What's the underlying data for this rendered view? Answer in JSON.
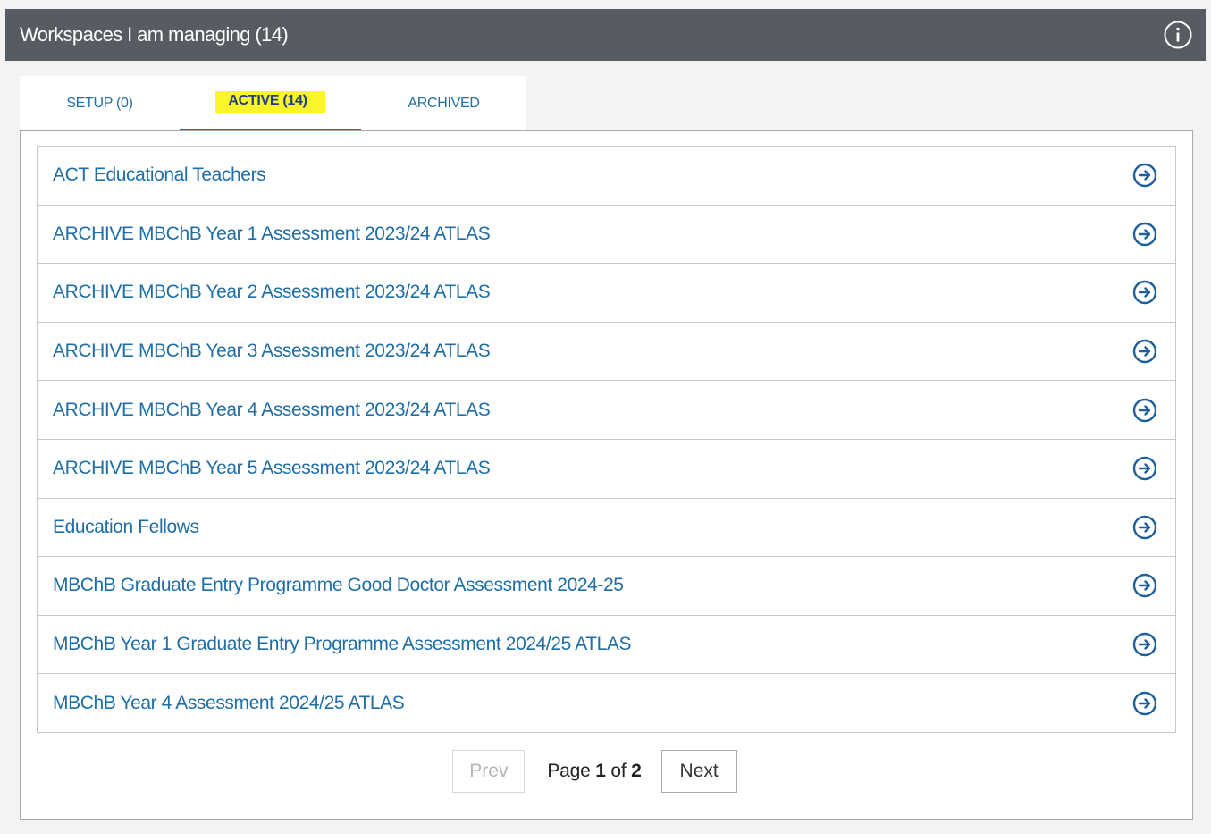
{
  "header": {
    "title": "Workspaces I am managing (14)",
    "info_icon": "info-circle-icon"
  },
  "tabs": [
    {
      "label": "SETUP (0)",
      "active": false
    },
    {
      "label": "ACTIVE (14)",
      "active": true
    },
    {
      "label": "ARCHIVED",
      "active": false
    }
  ],
  "workspaces": [
    {
      "label": "ACT Educational Teachers"
    },
    {
      "label": "ARCHIVE MBChB Year 1 Assessment 2023/24 ATLAS"
    },
    {
      "label": "ARCHIVE MBChB Year 2 Assessment 2023/24 ATLAS"
    },
    {
      "label": "ARCHIVE MBChB Year 3 Assessment 2023/24 ATLAS"
    },
    {
      "label": "ARCHIVE MBChB Year 4 Assessment 2023/24 ATLAS"
    },
    {
      "label": "ARCHIVE MBChB Year 5 Assessment 2023/24 ATLAS"
    },
    {
      "label": "Education Fellows"
    },
    {
      "label": "MBChB Graduate Entry Programme Good Doctor Assessment 2024-25"
    },
    {
      "label": "MBChB Year 1 Graduate Entry Programme Assessment 2024/25 ATLAS"
    },
    {
      "label": "MBChB Year 4 Assessment 2024/25 ATLAS"
    }
  ],
  "row_icon": "arrow-right-circle-icon",
  "pagination": {
    "prev_label": "Prev",
    "next_label": "Next",
    "page_word": "Page",
    "current_page": "1",
    "of_word": "of",
    "total_pages": "2"
  },
  "colors": {
    "header_bg": "#575c63",
    "link": "#1f6ea6",
    "highlight": "#fcf52a"
  }
}
